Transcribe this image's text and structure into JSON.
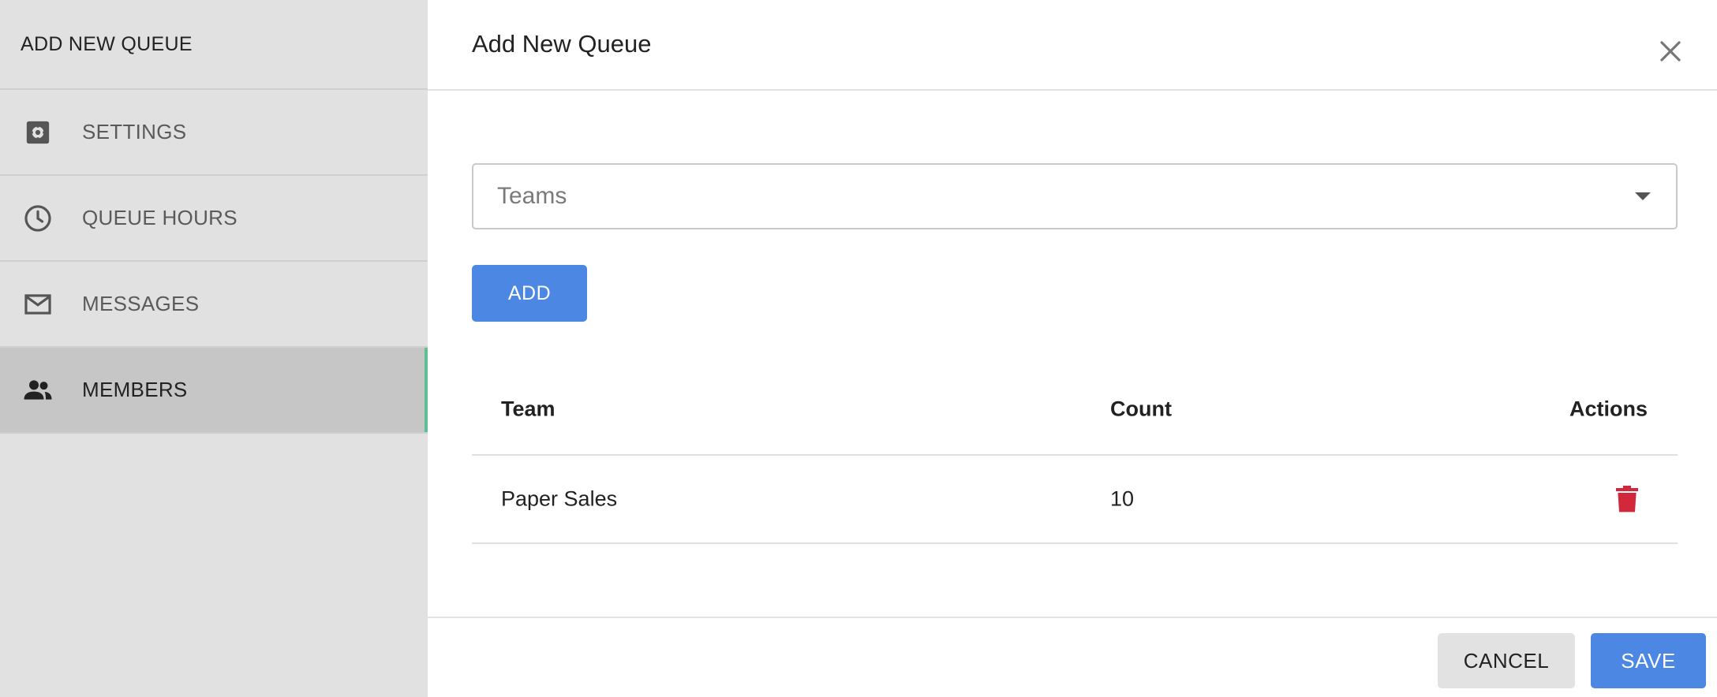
{
  "sidebar": {
    "title": "ADD NEW QUEUE",
    "items": [
      {
        "label": "SETTINGS",
        "icon": "settings-icon"
      },
      {
        "label": "QUEUE HOURS",
        "icon": "clock-icon"
      },
      {
        "label": "MESSAGES",
        "icon": "mail-icon"
      },
      {
        "label": "MEMBERS",
        "icon": "people-icon",
        "active": true
      }
    ],
    "active_accent": "#5fbf93"
  },
  "dialog": {
    "title": "Add New Queue",
    "close_icon": "close-icon"
  },
  "teams_select": {
    "placeholder": "Teams",
    "icon": "caret-down-icon"
  },
  "add_button": "ADD",
  "table": {
    "columns": [
      "Team",
      "Count",
      "Actions"
    ],
    "rows": [
      {
        "team": "Paper Sales",
        "count": "10",
        "action_icon": "trash-icon"
      }
    ]
  },
  "footer": {
    "cancel_label": "CANCEL",
    "save_label": "SAVE"
  },
  "colors": {
    "primary": "#4b87e3",
    "danger": "#d2283c",
    "sidebar_bg": "#e1e1e1",
    "sidebar_active_bg": "#c6c6c6"
  }
}
